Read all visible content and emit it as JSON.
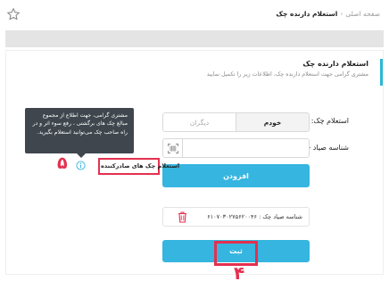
{
  "breadcrumb": {
    "home": "صفحه اصلی",
    "separator": "›",
    "current": "استعلام دارنده چک"
  },
  "header": {
    "title": "استعلام دارنده چک",
    "subtitle": "مشتری گرامی جهت استعلام دارنده چک، اطلاعات زیر را تکمیل نمایید"
  },
  "form": {
    "inquiry_label": "استعلام چک:",
    "toggle": {
      "selected": "خودم",
      "other": "دیگران"
    },
    "sayad_label": "شناسه صیاد چک:",
    "sayad_value": "",
    "add_button": "افزودن",
    "submit_button": "ثبت"
  },
  "result": {
    "sayad_text": "شناسه صیاد چک : ۶۱۰۷۰۳۰۲۷۵۶۲۰۰۴۶"
  },
  "issuer_inquiry_label": "استعلام چک های صادرکننده",
  "tooltip": {
    "lines": [
      "مشتری گرامی، جهت اطلاع از مجموع",
      "مبالغ چک های برگشتی ، رفع سوء اثر و در",
      "راه صاحب چک می‌توانید استعلام بگیرید."
    ]
  },
  "annotations": {
    "step_4": "۴",
    "step_5": "۵"
  },
  "colors": {
    "accent": "#35b5e0",
    "highlight": "#e4304f",
    "tooltip_bg": "#3f464e"
  },
  "icons": [
    "star-icon",
    "barcode-scan-icon",
    "trash-icon",
    "info-icon"
  ]
}
